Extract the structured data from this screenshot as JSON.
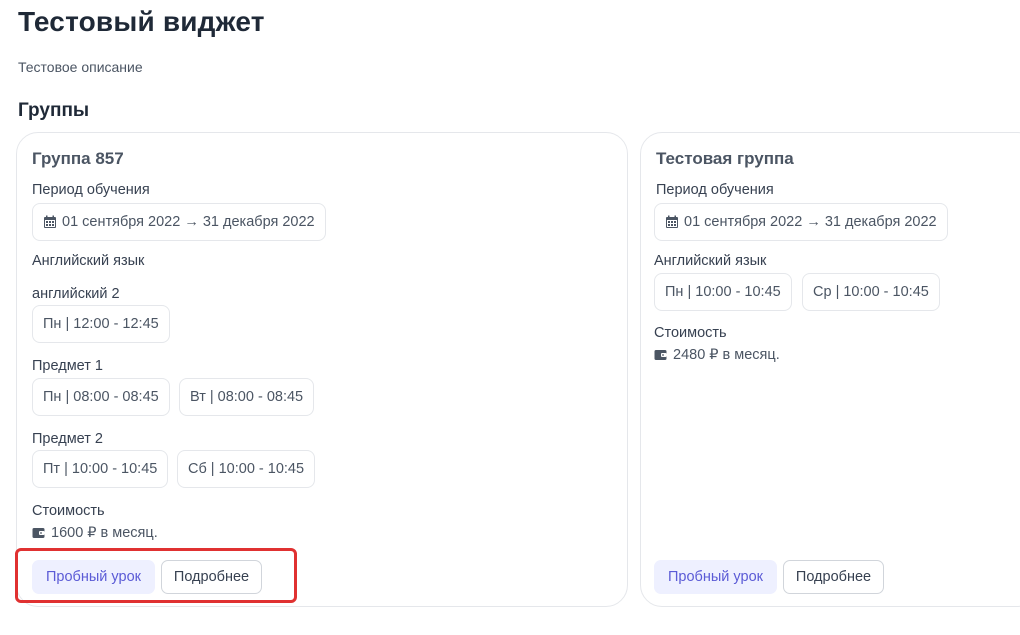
{
  "widget": {
    "title": "Тестовый виджет",
    "description": "Тестовое описание",
    "groups_heading": "Группы"
  },
  "groups": [
    {
      "name": "Группа 857",
      "period_label": "Период обучения",
      "period": "01 сентября 2022 → 31 декабря 2022",
      "subjects": [
        {
          "name": "Английский язык",
          "slots": []
        },
        {
          "name": "английский 2",
          "slots": [
            "Пн | 12:00 - 12:45"
          ]
        },
        {
          "name": "Предмет 1",
          "slots": [
            "Пн | 08:00 - 08:45",
            "Вт | 08:00 - 08:45"
          ]
        },
        {
          "name": "Предмет 2",
          "slots": [
            "Пт | 10:00 - 10:45",
            "Сб | 10:00 - 10:45"
          ]
        }
      ],
      "price_label": "Стоимость",
      "price": "1600 ₽ в месяц.",
      "trial_button": "Пробный урок",
      "details_button": "Подробнее"
    },
    {
      "name": "Тестовая группа",
      "period_label": "Период обучения",
      "period": "01 сентября 2022 → 31 декабря 2022",
      "subjects": [
        {
          "name": "Английский язык",
          "slots": [
            "Пн | 10:00 - 10:45",
            "Ср | 10:00 - 10:45"
          ]
        }
      ],
      "price_label": "Стоимость",
      "price": "2480 ₽ в месяц.",
      "trial_button": "Пробный урок",
      "details_button": "Подробнее"
    }
  ],
  "icons": {
    "period": "calendar-icon",
    "price": "wallet-icon"
  },
  "colors": {
    "primary_text": "#5b5bd6",
    "primary_bg": "#eef0ff",
    "highlight": "#e03131"
  }
}
